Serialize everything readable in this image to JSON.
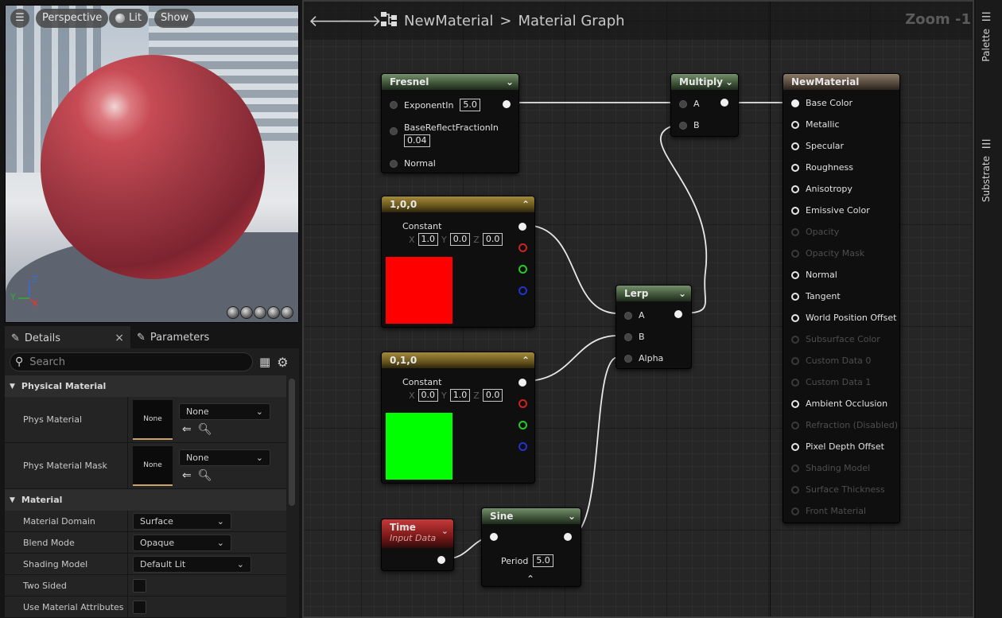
{
  "viewport": {
    "buttons": [
      "Perspective",
      "Lit",
      "Show"
    ],
    "axes": {
      "x": "X",
      "y": "Y",
      "z": "Z"
    },
    "menu_icon": "hamburger-icon",
    "lit_icon": "lit-sphere-icon",
    "preview_shapes": [
      "cylinder",
      "sphere",
      "plane",
      "cube",
      "teapot"
    ]
  },
  "details": {
    "tab_details": "Details",
    "tab_close": "×",
    "tab_parameters": "Parameters",
    "search_placeholder": "Search",
    "cat_physical": "Physical Material",
    "phys_material_label": "Phys Material",
    "phys_material_thumb": "None",
    "phys_material_value": "None",
    "phys_mask_label": "Phys Material Mask",
    "phys_mask_thumb": "None",
    "phys_mask_value": "None",
    "cat_material": "Material",
    "rows": [
      {
        "label": "Material Domain",
        "value": "Surface"
      },
      {
        "label": "Blend Mode",
        "value": "Opaque"
      },
      {
        "label": "Shading Model",
        "value": "Default Lit"
      },
      {
        "label": "Two Sided",
        "value": ""
      },
      {
        "label": "Use Material Attributes",
        "value": ""
      }
    ]
  },
  "graph": {
    "breadcrumb_asset": "NewMaterial",
    "breadcrumb_sep": ">",
    "breadcrumb_view": "Material Graph",
    "zoom": "Zoom -1",
    "fresnel": {
      "title": "Fresnel",
      "exponent_label": "ExponentIn",
      "exponent": "5.0",
      "base_label": "BaseReflectFractionIn",
      "base": "0.04",
      "normal_label": "Normal"
    },
    "const_red": {
      "title": "1,0,0",
      "label": "Constant",
      "x": "1.0",
      "y": "0.0",
      "z": "0.0",
      "color": "#ff0000"
    },
    "const_green": {
      "title": "0,1,0",
      "label": "Constant",
      "x": "0.0",
      "y": "1.0",
      "z": "0.0",
      "color": "#00ff00"
    },
    "axis_x": "X",
    "axis_y": "Y",
    "axis_z": "Z",
    "time": {
      "title": "Time",
      "subtitle": "Input Data"
    },
    "sine": {
      "title": "Sine",
      "period_label": "Period",
      "period": "5.0"
    },
    "lerp": {
      "title": "Lerp",
      "a": "A",
      "b": "B",
      "alpha": "Alpha"
    },
    "multiply": {
      "title": "Multiply",
      "a": "A",
      "b": "B"
    },
    "result": {
      "title": "NewMaterial",
      "pins": [
        {
          "label": "Base Color",
          "state": "connected"
        },
        {
          "label": "Metallic",
          "state": "on"
        },
        {
          "label": "Specular",
          "state": "on"
        },
        {
          "label": "Roughness",
          "state": "on"
        },
        {
          "label": "Anisotropy",
          "state": "on"
        },
        {
          "label": "Emissive Color",
          "state": "on"
        },
        {
          "label": "Opacity",
          "state": "off"
        },
        {
          "label": "Opacity Mask",
          "state": "off"
        },
        {
          "label": "Normal",
          "state": "on"
        },
        {
          "label": "Tangent",
          "state": "on"
        },
        {
          "label": "World Position Offset",
          "state": "on"
        },
        {
          "label": "Subsurface Color",
          "state": "off"
        },
        {
          "label": "Custom Data 0",
          "state": "off"
        },
        {
          "label": "Custom Data 1",
          "state": "off"
        },
        {
          "label": "Ambient Occlusion",
          "state": "on"
        },
        {
          "label": "Refraction (Disabled)",
          "state": "off"
        },
        {
          "label": "Pixel Depth Offset",
          "state": "on"
        },
        {
          "label": "Shading Model",
          "state": "off"
        },
        {
          "label": "Surface Thickness",
          "state": "off"
        },
        {
          "label": "Front Material",
          "state": "off"
        }
      ]
    }
  },
  "sidebar": {
    "palette": "Palette",
    "substrate": "Substrate"
  },
  "colors": {
    "red_pin": "#cc2222",
    "green_pin": "#22cc22",
    "blue_pin": "#2233cc",
    "asset_thumb_accent": "#c7a463"
  }
}
